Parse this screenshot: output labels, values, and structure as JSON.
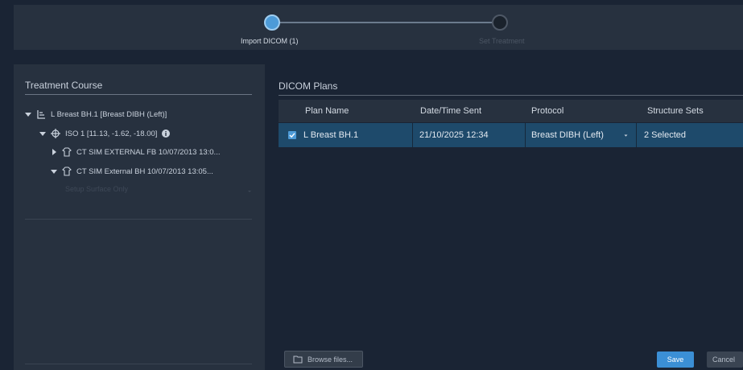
{
  "stepper": {
    "steps": [
      {
        "label": "Import DICOM (1)",
        "state": "active"
      },
      {
        "label": "Set Treatment",
        "state": "todo"
      }
    ]
  },
  "treatment_course": {
    "title": "Treatment Course",
    "course": "L Breast BH.1 [Breast DIBH (Left)]",
    "iso": "ISO 1 [11.13, -1.62, -18.00]",
    "structures": [
      {
        "label": "CT SIM EXTERNAL FB 10/07/2013 13:0...",
        "expanded": false
      },
      {
        "label": "CT SIM External BH 10/07/2013 13:05...",
        "expanded": true
      }
    ],
    "setup_select": "Setup Surface Only"
  },
  "dicom_plans": {
    "title": "DICOM Plans",
    "columns": [
      "Plan Name",
      "Date/Time Sent",
      "Protocol",
      "Structure Sets"
    ],
    "rows": [
      {
        "checked": true,
        "plan_name": "L Breast BH.1",
        "date_sent": "21/10/2025 12:34",
        "protocol": "Breast DIBH (Left)",
        "structure_sets": "2 Selected"
      }
    ]
  },
  "footer": {
    "browse_label": "Browse files...",
    "save_label": "Save",
    "cancel_label": "Cancel"
  },
  "colors": {
    "accent": "#3b8fd5",
    "selected_row": "#1e4a6b",
    "panel": "#27313f",
    "background": "#1a2434"
  }
}
